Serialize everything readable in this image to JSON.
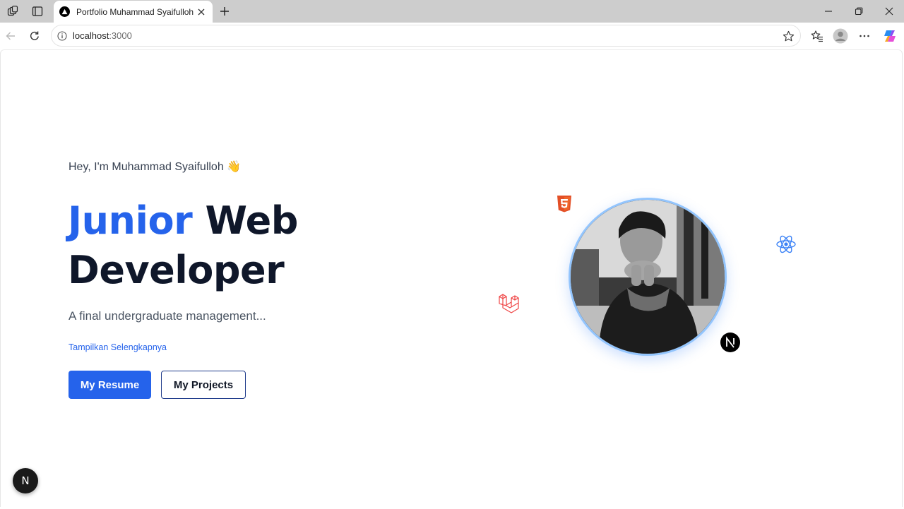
{
  "browser": {
    "tab_title": "Portfolio Muhammad Syaifulloh",
    "url_host": "localhost",
    "url_port": ":3000"
  },
  "hero": {
    "greeting": "Hey, I'm Muhammad Syaifulloh 👋",
    "title_accent": "Junior",
    "title_rest_1": "Web",
    "title_rest_2": "Developer",
    "description": "A final undergraduate management...",
    "show_more": "Tampilkan Selengkapnya",
    "resume_button": "My Resume",
    "projects_button": "My Projects"
  },
  "tech_icons": [
    "html5-icon",
    "react-icon",
    "laravel-icon",
    "nextjs-icon"
  ],
  "dev_badge_letter": "N",
  "colors": {
    "accent": "#2563eb",
    "heading": "#0f172a",
    "html5": "#e34f26",
    "react": "#3b82f6",
    "laravel": "#ef4444",
    "avatar_ring": "#93c5fd"
  }
}
